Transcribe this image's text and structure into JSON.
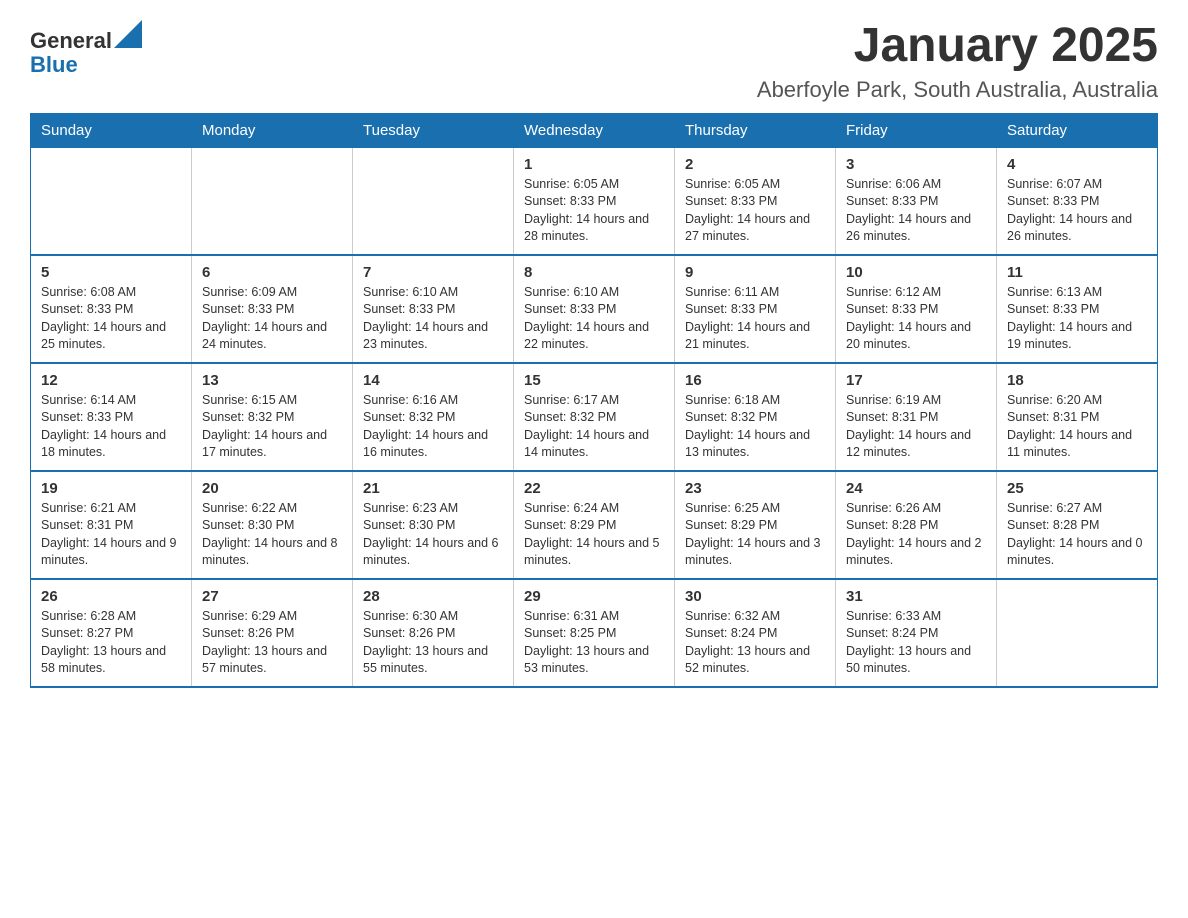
{
  "header": {
    "logo_general": "General",
    "logo_blue": "Blue",
    "title": "January 2025",
    "subtitle": "Aberfoyle Park, South Australia, Australia"
  },
  "days_of_week": [
    "Sunday",
    "Monday",
    "Tuesday",
    "Wednesday",
    "Thursday",
    "Friday",
    "Saturday"
  ],
  "weeks": [
    [
      {
        "day": "",
        "info": ""
      },
      {
        "day": "",
        "info": ""
      },
      {
        "day": "",
        "info": ""
      },
      {
        "day": "1",
        "info": "Sunrise: 6:05 AM\nSunset: 8:33 PM\nDaylight: 14 hours and 28 minutes."
      },
      {
        "day": "2",
        "info": "Sunrise: 6:05 AM\nSunset: 8:33 PM\nDaylight: 14 hours and 27 minutes."
      },
      {
        "day": "3",
        "info": "Sunrise: 6:06 AM\nSunset: 8:33 PM\nDaylight: 14 hours and 26 minutes."
      },
      {
        "day": "4",
        "info": "Sunrise: 6:07 AM\nSunset: 8:33 PM\nDaylight: 14 hours and 26 minutes."
      }
    ],
    [
      {
        "day": "5",
        "info": "Sunrise: 6:08 AM\nSunset: 8:33 PM\nDaylight: 14 hours and 25 minutes."
      },
      {
        "day": "6",
        "info": "Sunrise: 6:09 AM\nSunset: 8:33 PM\nDaylight: 14 hours and 24 minutes."
      },
      {
        "day": "7",
        "info": "Sunrise: 6:10 AM\nSunset: 8:33 PM\nDaylight: 14 hours and 23 minutes."
      },
      {
        "day": "8",
        "info": "Sunrise: 6:10 AM\nSunset: 8:33 PM\nDaylight: 14 hours and 22 minutes."
      },
      {
        "day": "9",
        "info": "Sunrise: 6:11 AM\nSunset: 8:33 PM\nDaylight: 14 hours and 21 minutes."
      },
      {
        "day": "10",
        "info": "Sunrise: 6:12 AM\nSunset: 8:33 PM\nDaylight: 14 hours and 20 minutes."
      },
      {
        "day": "11",
        "info": "Sunrise: 6:13 AM\nSunset: 8:33 PM\nDaylight: 14 hours and 19 minutes."
      }
    ],
    [
      {
        "day": "12",
        "info": "Sunrise: 6:14 AM\nSunset: 8:33 PM\nDaylight: 14 hours and 18 minutes."
      },
      {
        "day": "13",
        "info": "Sunrise: 6:15 AM\nSunset: 8:32 PM\nDaylight: 14 hours and 17 minutes."
      },
      {
        "day": "14",
        "info": "Sunrise: 6:16 AM\nSunset: 8:32 PM\nDaylight: 14 hours and 16 minutes."
      },
      {
        "day": "15",
        "info": "Sunrise: 6:17 AM\nSunset: 8:32 PM\nDaylight: 14 hours and 14 minutes."
      },
      {
        "day": "16",
        "info": "Sunrise: 6:18 AM\nSunset: 8:32 PM\nDaylight: 14 hours and 13 minutes."
      },
      {
        "day": "17",
        "info": "Sunrise: 6:19 AM\nSunset: 8:31 PM\nDaylight: 14 hours and 12 minutes."
      },
      {
        "day": "18",
        "info": "Sunrise: 6:20 AM\nSunset: 8:31 PM\nDaylight: 14 hours and 11 minutes."
      }
    ],
    [
      {
        "day": "19",
        "info": "Sunrise: 6:21 AM\nSunset: 8:31 PM\nDaylight: 14 hours and 9 minutes."
      },
      {
        "day": "20",
        "info": "Sunrise: 6:22 AM\nSunset: 8:30 PM\nDaylight: 14 hours and 8 minutes."
      },
      {
        "day": "21",
        "info": "Sunrise: 6:23 AM\nSunset: 8:30 PM\nDaylight: 14 hours and 6 minutes."
      },
      {
        "day": "22",
        "info": "Sunrise: 6:24 AM\nSunset: 8:29 PM\nDaylight: 14 hours and 5 minutes."
      },
      {
        "day": "23",
        "info": "Sunrise: 6:25 AM\nSunset: 8:29 PM\nDaylight: 14 hours and 3 minutes."
      },
      {
        "day": "24",
        "info": "Sunrise: 6:26 AM\nSunset: 8:28 PM\nDaylight: 14 hours and 2 minutes."
      },
      {
        "day": "25",
        "info": "Sunrise: 6:27 AM\nSunset: 8:28 PM\nDaylight: 14 hours and 0 minutes."
      }
    ],
    [
      {
        "day": "26",
        "info": "Sunrise: 6:28 AM\nSunset: 8:27 PM\nDaylight: 13 hours and 58 minutes."
      },
      {
        "day": "27",
        "info": "Sunrise: 6:29 AM\nSunset: 8:26 PM\nDaylight: 13 hours and 57 minutes."
      },
      {
        "day": "28",
        "info": "Sunrise: 6:30 AM\nSunset: 8:26 PM\nDaylight: 13 hours and 55 minutes."
      },
      {
        "day": "29",
        "info": "Sunrise: 6:31 AM\nSunset: 8:25 PM\nDaylight: 13 hours and 53 minutes."
      },
      {
        "day": "30",
        "info": "Sunrise: 6:32 AM\nSunset: 8:24 PM\nDaylight: 13 hours and 52 minutes."
      },
      {
        "day": "31",
        "info": "Sunrise: 6:33 AM\nSunset: 8:24 PM\nDaylight: 13 hours and 50 minutes."
      },
      {
        "day": "",
        "info": ""
      }
    ]
  ]
}
